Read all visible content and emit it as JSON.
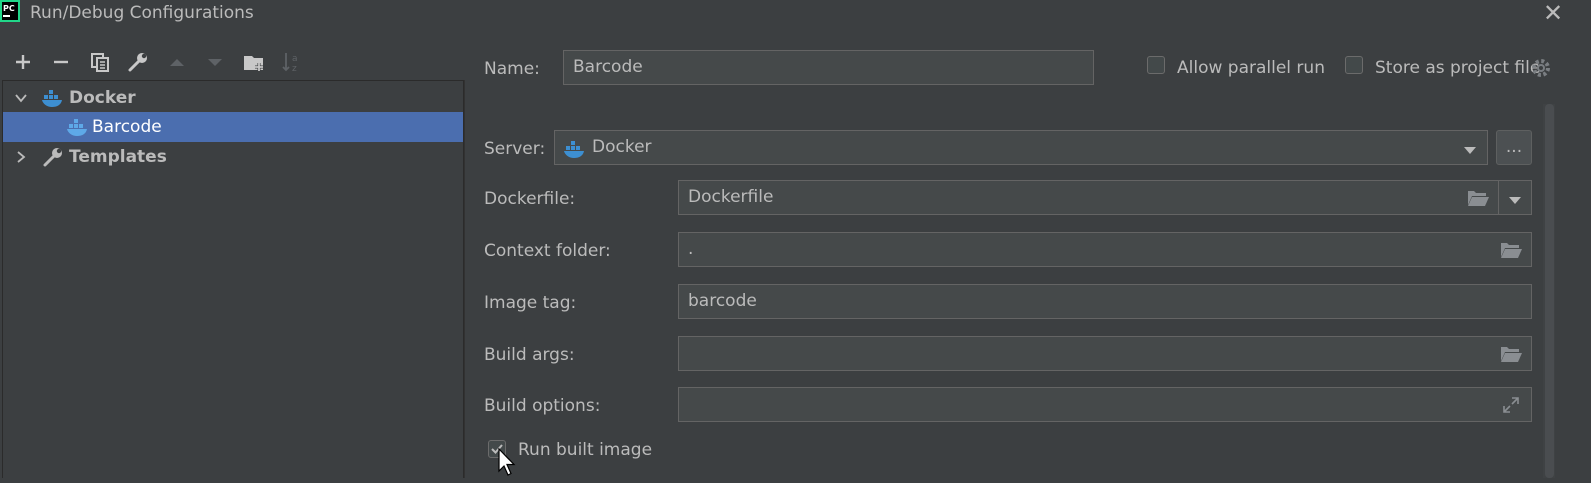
{
  "window": {
    "title": "Run/Debug Configurations",
    "logo_text": "PC",
    "close_icon": "close-icon"
  },
  "toolbar": {
    "icons": [
      "add-icon",
      "remove-icon",
      "copy-icon",
      "wrench-icon",
      "move-up-icon",
      "move-down-icon",
      "new-folder-icon",
      "sort-az-icon"
    ]
  },
  "tree": {
    "items": [
      {
        "label": "Docker",
        "icon": "docker-icon",
        "expanded": true,
        "bold": true
      },
      {
        "label": "Barcode",
        "icon": "docker-icon",
        "selected": true
      },
      {
        "label": "Templates",
        "icon": "wrench-icon",
        "expanded": false,
        "bold": true
      }
    ]
  },
  "config": {
    "name_label": "Name:",
    "name_value": "Barcode",
    "allow_parallel_label": "Allow parallel run",
    "allow_parallel_checked": false,
    "store_project_label": "Store as project file",
    "store_project_checked": false,
    "server_label": "Server:",
    "server_value": "Docker",
    "server_more": "...",
    "dockerfile_label": "Dockerfile:",
    "dockerfile_value": "Dockerfile",
    "context_label": "Context folder:",
    "context_value": ".",
    "image_tag_label": "Image tag:",
    "image_tag_value": "barcode",
    "build_args_label": "Build args:",
    "build_args_value": "",
    "build_options_label": "Build options:",
    "build_options_value": "",
    "run_built_label": "Run built image",
    "run_built_checked": true
  },
  "colors": {
    "background": "#3c3f41",
    "selection": "#4b6eaf",
    "field": "#45494a",
    "docker_blue": "#3d8fd1"
  }
}
